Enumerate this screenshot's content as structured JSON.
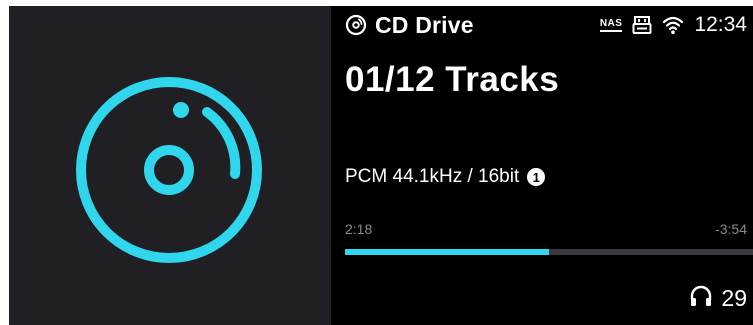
{
  "colors": {
    "accent": "#2fd6ec",
    "background": "#000000",
    "art_panel": "#1f1f24",
    "muted_text": "#8a8a8a",
    "progress_track": "#3a3a3e"
  },
  "album_art": {
    "icon": "cd-disc-icon"
  },
  "status_bar": {
    "source_icon": "disc-icon",
    "source_label": "CD Drive",
    "nas_label": "NAS",
    "usb_icon": "usb-icon",
    "wifi_icon": "wifi-icon",
    "time": "12:34"
  },
  "track": {
    "count_label": "01/12 Tracks"
  },
  "format": {
    "label": "PCM 44.1kHz / 16bit",
    "badge": "1"
  },
  "playback": {
    "elapsed": "2:18",
    "remaining": "-3:54",
    "progress": 0.5
  },
  "volume": {
    "icon": "headphones-icon",
    "value": "29"
  }
}
